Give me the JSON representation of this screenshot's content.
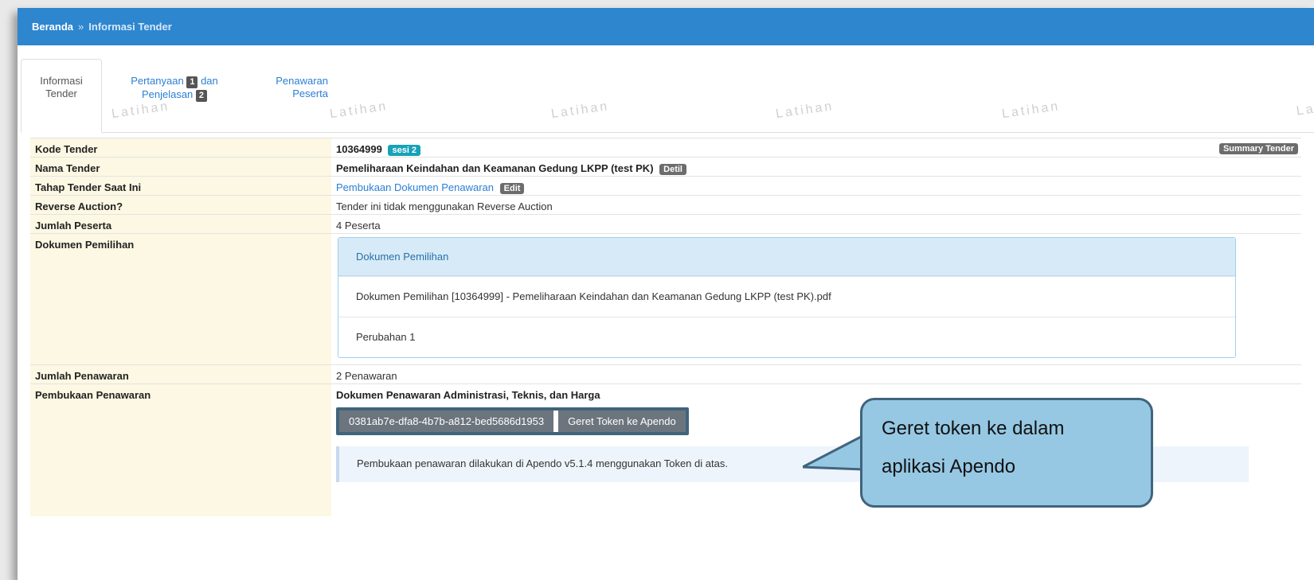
{
  "breadcrumb": {
    "home": "Beranda",
    "separator": "»",
    "current": "Informasi Tender"
  },
  "tabs": {
    "info": {
      "line1": "Informasi",
      "line2": "Tender"
    },
    "qa": {
      "pre": "Pertanyaan",
      "badge1": "1",
      "mid": "dan",
      "line2": "Penjelasan",
      "badge2": "2"
    },
    "offers": {
      "line1": "Penawaran",
      "line2": "Peserta"
    }
  },
  "watermark": {
    "text": "Latihan",
    "partial": "La"
  },
  "rows": {
    "kode": {
      "label": "Kode Tender",
      "value": "10364999",
      "session": "sesi 2",
      "summary_btn": "Summary Tender"
    },
    "nama": {
      "label": "Nama Tender",
      "value": "Pemeliharaan Keindahan dan Keamanan Gedung LKPP (test PK)",
      "detail_btn": "Detil"
    },
    "tahap": {
      "label": "Tahap Tender Saat Ini",
      "value": "Pembukaan Dokumen Penawaran",
      "edit_btn": "Edit"
    },
    "reverse": {
      "label": "Reverse Auction?",
      "value": "Tender ini tidak menggunakan Reverse Auction"
    },
    "peserta": {
      "label": "Jumlah Peserta",
      "value": "4 Peserta"
    },
    "dokumen": {
      "label": "Dokumen Pemilihan",
      "panel_title": "Dokumen Pemilihan",
      "items": [
        "Dokumen Pemilihan [10364999] - Pemeliharaan Keindahan dan Keamanan Gedung LKPP (test PK).pdf",
        "Perubahan 1"
      ]
    },
    "jumlah_penawaran": {
      "label": "Jumlah Penawaran",
      "value": "2 Penawaran"
    },
    "pembukaan": {
      "label": "Pembukaan Penawaran",
      "heading": "Dokumen Penawaran Administrasi, Teknis, dan Harga",
      "token": "0381ab7e-dfa8-4b7b-a812-bed5686d1953",
      "token_btn": "Geret Token ke Apendo",
      "note": "Pembukaan penawaran dilakukan di Apendo v5.1.4 menggunakan Token di atas."
    }
  },
  "callout": {
    "line1": "Geret token ke dalam",
    "line2": "aplikasi Apendo"
  },
  "colors": {
    "topbar": "#2e86cf",
    "label_bg": "#fcf8e3",
    "session_badge": "#17a2b8",
    "callout_bg": "#96c8e4",
    "callout_border": "#40647c"
  }
}
